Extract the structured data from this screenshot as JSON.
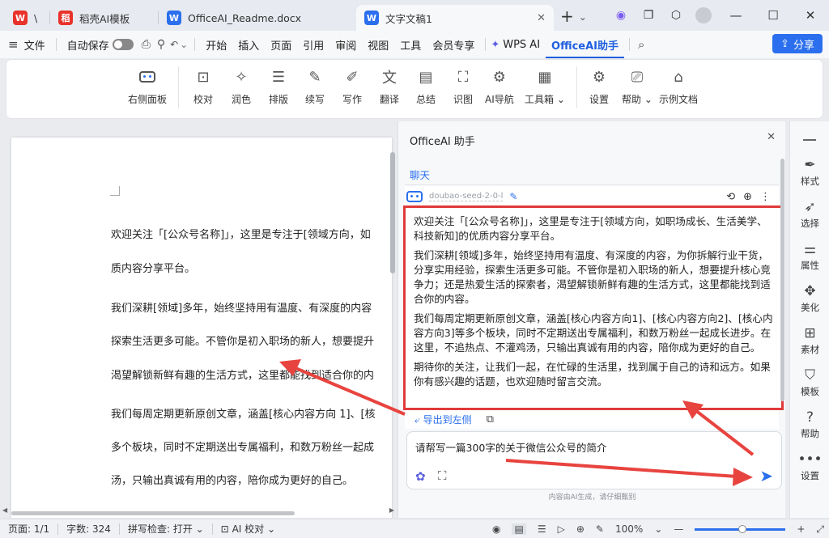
{
  "titlebar": {
    "tabs": [
      {
        "logo": "W",
        "label": "\\",
        "logo_color": "#e8322b"
      },
      {
        "logo": "稻",
        "label": "稻壳AI模板",
        "logo_color": "#e8322b"
      },
      {
        "logo": "W",
        "label": "OfficeAI_Readme.docx",
        "logo_color": "#2b6fee"
      },
      {
        "logo": "W",
        "label": "文字文稿1",
        "logo_color": "#2b6fee"
      }
    ],
    "add": "+",
    "chevron": "⌄"
  },
  "menubar": {
    "file": "文件",
    "autosave": "自动保存",
    "items": [
      "开始",
      "插入",
      "页面",
      "引用",
      "审阅",
      "视图",
      "工具",
      "会员专享",
      "WPS AI",
      "OfficeAI助手"
    ],
    "share": "分享"
  },
  "ribbon": {
    "buttons": [
      "右侧面板",
      "校对",
      "润色",
      "排版",
      "续写",
      "写作",
      "翻译",
      "总结",
      "识图",
      "AI导航",
      "工具箱",
      "设置",
      "帮助",
      "示例文档"
    ]
  },
  "document": {
    "lines": [
      "欢迎关注「[公众号名称]」，这里是专注于[领域方向，如",
      "质内容分享平台。",
      "我们深耕[领域]多年，始终坚持用有温度、有深度的内容",
      "探索生活更多可能。不管你是初入职场的新人，想要提升",
      "渴望解锁新鲜有趣的生活方式，这里都能找到适合你的内",
      "我们每周定期更新原创文章，涵盖[核心内容方向 1]、[核",
      "多个板块，同时不定期送出专属福利，和数万粉丝一起成",
      "汤，只输出真诚有用的内容，陪你成为更好的自己。"
    ]
  },
  "panel": {
    "title": "OfficeAI 助手",
    "tab": "聊天",
    "model": "doubao-seed-2-0-l",
    "reply": [
      "欢迎关注「[公众号名称]」，这里是专注于[领域方向，如职场成长、生活美学、科技新知]的优质内容分享平台。",
      "我们深耕[领域]多年，始终坚持用有温度、有深度的内容，为你拆解行业干货，分享实用经验，探索生活更多可能。不管你是初入职场的新人，想要提升核心竞争力；还是热爱生活的探索者，渴望解锁新鲜有趣的生活方式，这里都能找到适合你的内容。",
      "我们每周定期更新原创文章，涵盖[核心内容方向1]、[核心内容方向2]、[核心内容方向3]等多个板块，同时不定期送出专属福利，和数万粉丝一起成长进步。在这里，不追热点、不灌鸡汤，只输出真诚有用的内容，陪你成为更好的自己。",
      "期待你的关注，让我们一起，在忙碌的生活里，找到属于自己的诗和远方。如果你有感兴趣的话题，也欢迎随时留言交流。"
    ],
    "export": "导出到左侧",
    "input": "请帮写一篇300字的关于微信公众号的简介",
    "disclaimer": "内容由AI生成，请仔细甄别"
  },
  "rail": {
    "items": [
      "样式",
      "选择",
      "属性",
      "美化",
      "素材",
      "模板",
      "帮助",
      "设置"
    ]
  },
  "status": {
    "page": "页面: 1/1",
    "words": "字数: 324",
    "spell": "拼写检查: 打开",
    "ai_check": "AI 校对",
    "zoom": "100%"
  },
  "colors": {
    "accent": "#2b6fee",
    "highlight": "#e03a3a",
    "wps_red": "#e8322b"
  }
}
